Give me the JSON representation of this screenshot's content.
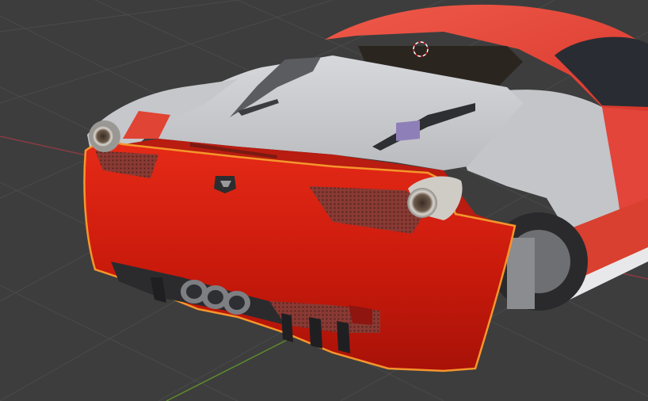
{
  "viewport": {
    "mode": "3d-viewport",
    "background_color": "#3d3d3d",
    "grid_line_color": "#4a4a4a",
    "axis_x_color": "#8a3b44",
    "axis_y_color": "#5e8a2e"
  },
  "scene": {
    "selected_object": "rear-bumper",
    "selection_outline_color": "#f5962c",
    "car_body_color": "#e8473a",
    "body_grey_color": "#c9cbcf",
    "bumper_color": "#d41e0e",
    "glass_color": "#2b2520"
  },
  "icons": {
    "cursor": "3d-cursor-icon",
    "badge": "horse-badge-icon"
  }
}
